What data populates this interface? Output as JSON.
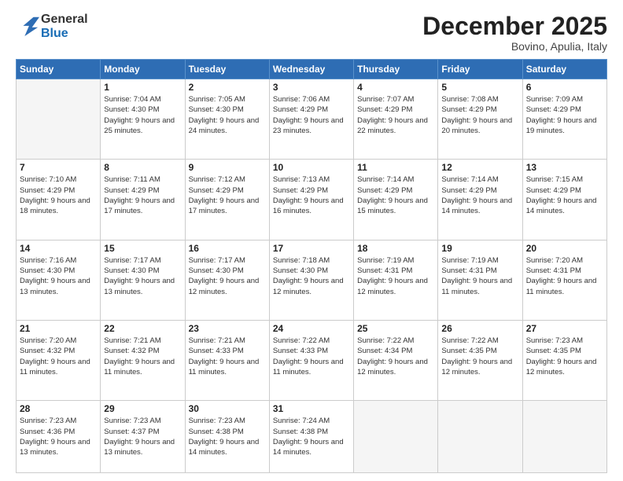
{
  "header": {
    "logo_line1": "General",
    "logo_line2": "Blue",
    "month": "December 2025",
    "location": "Bovino, Apulia, Italy"
  },
  "weekdays": [
    "Sunday",
    "Monday",
    "Tuesday",
    "Wednesday",
    "Thursday",
    "Friday",
    "Saturday"
  ],
  "weeks": [
    [
      {
        "day": "",
        "empty": true
      },
      {
        "day": "1",
        "sunrise": "7:04 AM",
        "sunset": "4:30 PM",
        "daylight": "9 hours and 25 minutes."
      },
      {
        "day": "2",
        "sunrise": "7:05 AM",
        "sunset": "4:30 PM",
        "daylight": "9 hours and 24 minutes."
      },
      {
        "day": "3",
        "sunrise": "7:06 AM",
        "sunset": "4:29 PM",
        "daylight": "9 hours and 23 minutes."
      },
      {
        "day": "4",
        "sunrise": "7:07 AM",
        "sunset": "4:29 PM",
        "daylight": "9 hours and 22 minutes."
      },
      {
        "day": "5",
        "sunrise": "7:08 AM",
        "sunset": "4:29 PM",
        "daylight": "9 hours and 20 minutes."
      },
      {
        "day": "6",
        "sunrise": "7:09 AM",
        "sunset": "4:29 PM",
        "daylight": "9 hours and 19 minutes."
      }
    ],
    [
      {
        "day": "7",
        "sunrise": "7:10 AM",
        "sunset": "4:29 PM",
        "daylight": "9 hours and 18 minutes."
      },
      {
        "day": "8",
        "sunrise": "7:11 AM",
        "sunset": "4:29 PM",
        "daylight": "9 hours and 17 minutes."
      },
      {
        "day": "9",
        "sunrise": "7:12 AM",
        "sunset": "4:29 PM",
        "daylight": "9 hours and 17 minutes."
      },
      {
        "day": "10",
        "sunrise": "7:13 AM",
        "sunset": "4:29 PM",
        "daylight": "9 hours and 16 minutes."
      },
      {
        "day": "11",
        "sunrise": "7:14 AM",
        "sunset": "4:29 PM",
        "daylight": "9 hours and 15 minutes."
      },
      {
        "day": "12",
        "sunrise": "7:14 AM",
        "sunset": "4:29 PM",
        "daylight": "9 hours and 14 minutes."
      },
      {
        "day": "13",
        "sunrise": "7:15 AM",
        "sunset": "4:29 PM",
        "daylight": "9 hours and 14 minutes."
      }
    ],
    [
      {
        "day": "14",
        "sunrise": "7:16 AM",
        "sunset": "4:30 PM",
        "daylight": "9 hours and 13 minutes."
      },
      {
        "day": "15",
        "sunrise": "7:17 AM",
        "sunset": "4:30 PM",
        "daylight": "9 hours and 13 minutes."
      },
      {
        "day": "16",
        "sunrise": "7:17 AM",
        "sunset": "4:30 PM",
        "daylight": "9 hours and 12 minutes."
      },
      {
        "day": "17",
        "sunrise": "7:18 AM",
        "sunset": "4:30 PM",
        "daylight": "9 hours and 12 minutes."
      },
      {
        "day": "18",
        "sunrise": "7:19 AM",
        "sunset": "4:31 PM",
        "daylight": "9 hours and 12 minutes."
      },
      {
        "day": "19",
        "sunrise": "7:19 AM",
        "sunset": "4:31 PM",
        "daylight": "9 hours and 11 minutes."
      },
      {
        "day": "20",
        "sunrise": "7:20 AM",
        "sunset": "4:31 PM",
        "daylight": "9 hours and 11 minutes."
      }
    ],
    [
      {
        "day": "21",
        "sunrise": "7:20 AM",
        "sunset": "4:32 PM",
        "daylight": "9 hours and 11 minutes."
      },
      {
        "day": "22",
        "sunrise": "7:21 AM",
        "sunset": "4:32 PM",
        "daylight": "9 hours and 11 minutes."
      },
      {
        "day": "23",
        "sunrise": "7:21 AM",
        "sunset": "4:33 PM",
        "daylight": "9 hours and 11 minutes."
      },
      {
        "day": "24",
        "sunrise": "7:22 AM",
        "sunset": "4:33 PM",
        "daylight": "9 hours and 11 minutes."
      },
      {
        "day": "25",
        "sunrise": "7:22 AM",
        "sunset": "4:34 PM",
        "daylight": "9 hours and 12 minutes."
      },
      {
        "day": "26",
        "sunrise": "7:22 AM",
        "sunset": "4:35 PM",
        "daylight": "9 hours and 12 minutes."
      },
      {
        "day": "27",
        "sunrise": "7:23 AM",
        "sunset": "4:35 PM",
        "daylight": "9 hours and 12 minutes."
      }
    ],
    [
      {
        "day": "28",
        "sunrise": "7:23 AM",
        "sunset": "4:36 PM",
        "daylight": "9 hours and 13 minutes."
      },
      {
        "day": "29",
        "sunrise": "7:23 AM",
        "sunset": "4:37 PM",
        "daylight": "9 hours and 13 minutes."
      },
      {
        "day": "30",
        "sunrise": "7:23 AM",
        "sunset": "4:38 PM",
        "daylight": "9 hours and 14 minutes."
      },
      {
        "day": "31",
        "sunrise": "7:24 AM",
        "sunset": "4:38 PM",
        "daylight": "9 hours and 14 minutes."
      },
      {
        "day": "",
        "empty": true
      },
      {
        "day": "",
        "empty": true
      },
      {
        "day": "",
        "empty": true
      }
    ]
  ]
}
